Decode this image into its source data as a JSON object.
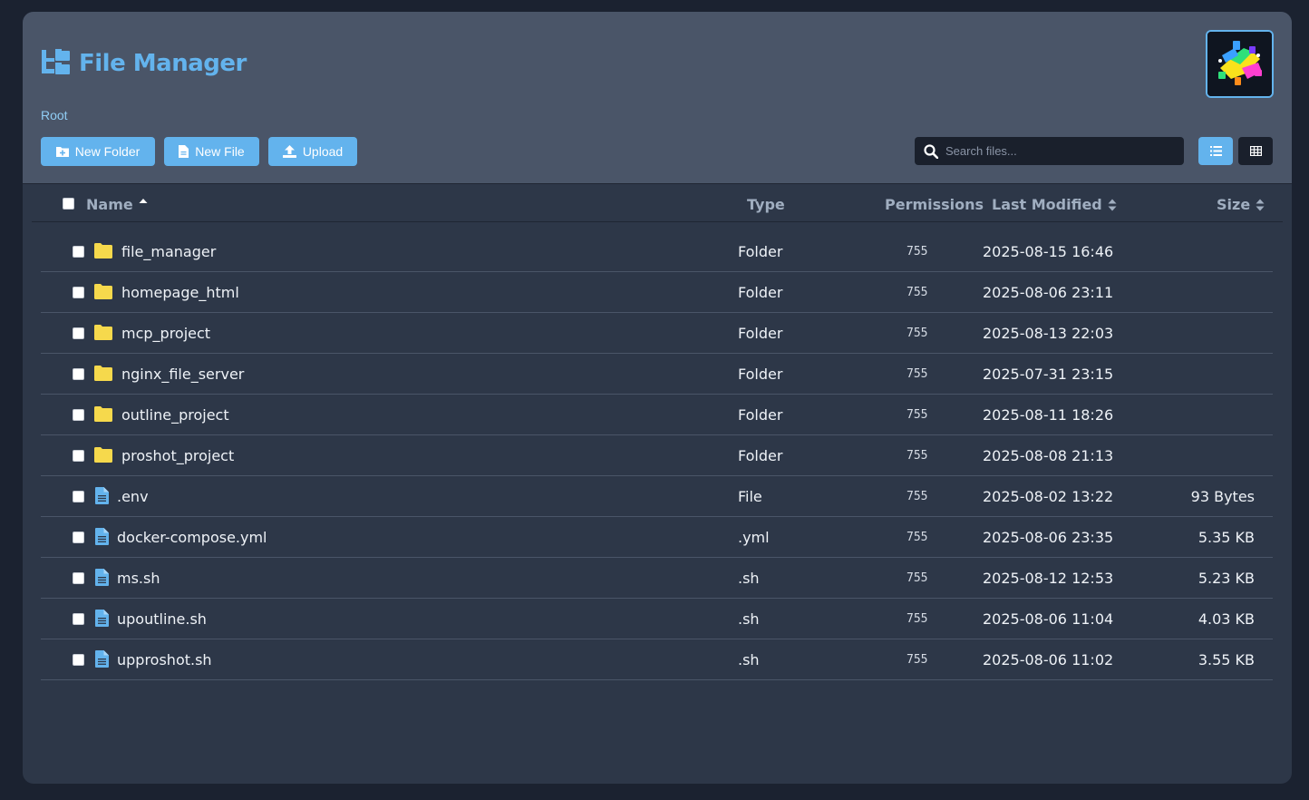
{
  "app": {
    "title": "File Manager",
    "breadcrumb": "Root"
  },
  "toolbar": {
    "new_folder": "New Folder",
    "new_file": "New File",
    "upload": "Upload",
    "search_placeholder": "Search files..."
  },
  "table": {
    "columns": {
      "name": "Name",
      "type": "Type",
      "permissions": "Permissions",
      "last_modified": "Last Modified",
      "size": "Size"
    },
    "rows": [
      {
        "name": "file_manager",
        "kind": "folder",
        "type": "Folder",
        "perm": "755",
        "modified": "2025-08-15 16:46",
        "size": ""
      },
      {
        "name": "homepage_html",
        "kind": "folder",
        "type": "Folder",
        "perm": "755",
        "modified": "2025-08-06 23:11",
        "size": ""
      },
      {
        "name": "mcp_project",
        "kind": "folder",
        "type": "Folder",
        "perm": "755",
        "modified": "2025-08-13 22:03",
        "size": ""
      },
      {
        "name": "nginx_file_server",
        "kind": "folder",
        "type": "Folder",
        "perm": "755",
        "modified": "2025-07-31 23:15",
        "size": ""
      },
      {
        "name": "outline_project",
        "kind": "folder",
        "type": "Folder",
        "perm": "755",
        "modified": "2025-08-11 18:26",
        "size": ""
      },
      {
        "name": "proshot_project",
        "kind": "folder",
        "type": "Folder",
        "perm": "755",
        "modified": "2025-08-08 21:13",
        "size": ""
      },
      {
        "name": ".env",
        "kind": "file",
        "type": "File",
        "perm": "755",
        "modified": "2025-08-02 13:22",
        "size": "93 Bytes"
      },
      {
        "name": "docker-compose.yml",
        "kind": "file",
        "type": ".yml",
        "perm": "755",
        "modified": "2025-08-06 23:35",
        "size": "5.35 KB"
      },
      {
        "name": "ms.sh",
        "kind": "file",
        "type": ".sh",
        "perm": "755",
        "modified": "2025-08-12 12:53",
        "size": "5.23 KB"
      },
      {
        "name": "upoutline.sh",
        "kind": "file",
        "type": ".sh",
        "perm": "755",
        "modified": "2025-08-06 11:04",
        "size": "4.03 KB"
      },
      {
        "name": "upproshot.sh",
        "kind": "file",
        "type": ".sh",
        "perm": "755",
        "modified": "2025-08-06 11:02",
        "size": "3.55 KB"
      }
    ]
  },
  "icons": {
    "folder": "folder-icon",
    "file": "file-icon"
  },
  "colors": {
    "accent": "#63b3ed",
    "folder": "#f6d94c",
    "file": "#63b3ed",
    "header_bg": "#4a5568",
    "body_bg": "#2d3748"
  }
}
